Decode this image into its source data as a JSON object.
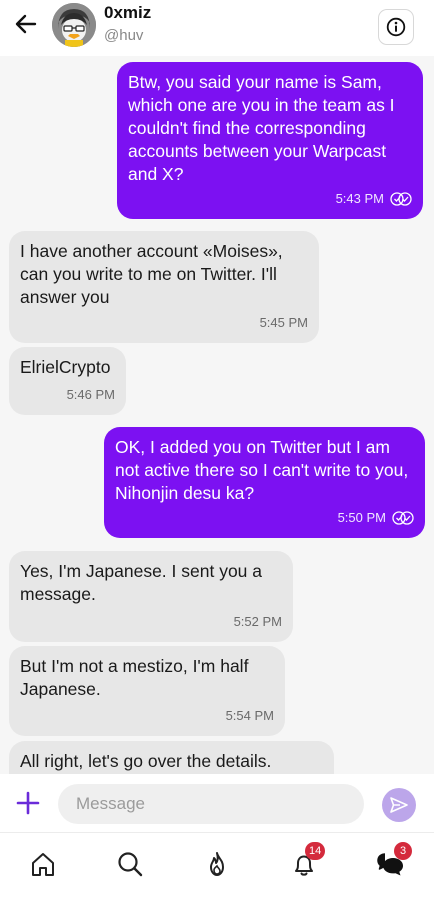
{
  "header": {
    "title": "0xmiz",
    "handle": "@huv"
  },
  "messages": [
    {
      "dir": "out",
      "text": "Btw, you said your name is Sam, which one are you in the team as I couldn't find the corresponding accounts between your Warpcast and X?",
      "time": "5:43 PM",
      "read": true
    },
    {
      "dir": "in",
      "text": "I have another account «Moises», can you write to me on Twitter. I'll answer you",
      "time": "5:45 PM"
    },
    {
      "dir": "in",
      "text": "ElrielCrypto",
      "time": "5:46 PM"
    },
    {
      "dir": "out",
      "text": "OK, I added you on Twitter but I am not active there so I can't write to you, Nihonjin desu ka?",
      "time": "5:50 PM",
      "read": true
    },
    {
      "dir": "in",
      "text": "Yes, I'm Japanese. I sent you a message.",
      "time": "5:52 PM"
    },
    {
      "dir": "in",
      "text": "But I'm not a mestizo, I'm half Japanese.",
      "time": "5:54 PM"
    },
    {
      "dir": "in",
      "text": "All right, let's go over the details.",
      "time": ""
    }
  ],
  "composer": {
    "placeholder": "Message"
  },
  "nav": {
    "notifications_badge": "14",
    "messages_badge": "3"
  },
  "colors": {
    "accent": "#7c11f2",
    "incoming": "#e7e7e7",
    "badge": "#d42a3c"
  },
  "icons": [
    "back-arrow-icon",
    "info-icon",
    "plus-icon",
    "send-icon",
    "home-icon",
    "search-icon",
    "flame-icon",
    "bell-icon",
    "chat-bubbles-icon"
  ]
}
